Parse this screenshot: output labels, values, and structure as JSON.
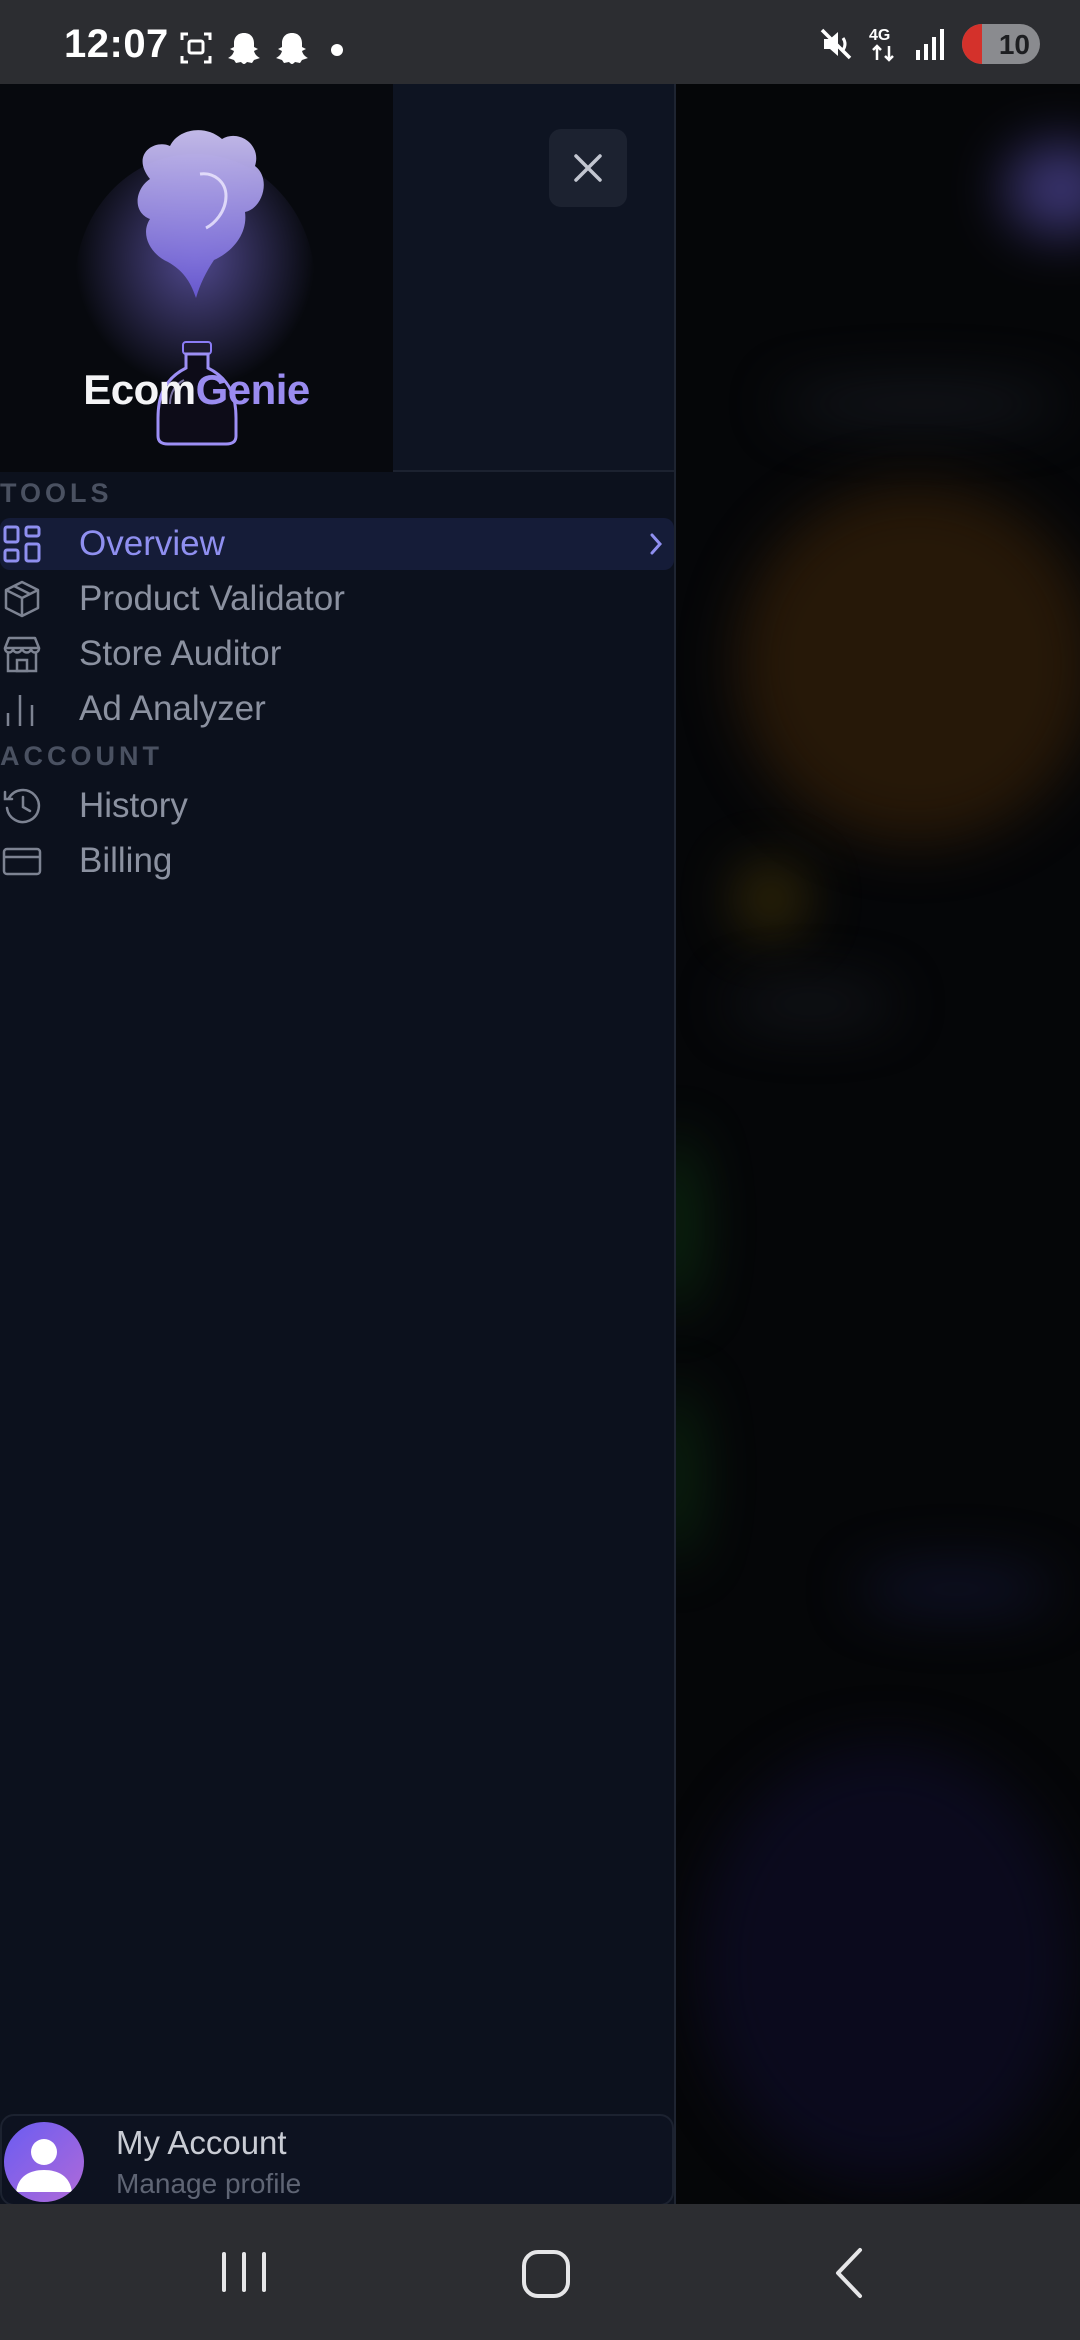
{
  "status_bar": {
    "time": "12:07",
    "left_icons": [
      "screenshot-icon",
      "snapchat-icon",
      "snapchat-icon",
      "dot-icon"
    ],
    "right_icons": [
      "mute-icon",
      "4g-icon",
      "signal-icon"
    ],
    "network": "4G",
    "battery_level": "10",
    "battery_color": "#d4312b"
  },
  "drawer": {
    "brand_part1": "Ecom",
    "brand_part2": "Genie",
    "brand_accent": "#9a8cf0",
    "close_icon": "close-icon",
    "sections": [
      {
        "label": "TOOLS",
        "items": [
          {
            "label": "Overview",
            "icon": "grid-icon",
            "active": true
          },
          {
            "label": "Product Validator",
            "icon": "box-icon",
            "active": false
          },
          {
            "label": "Store Auditor",
            "icon": "store-icon",
            "active": false
          },
          {
            "label": "Ad Analyzer",
            "icon": "bar-chart-icon",
            "active": false
          }
        ]
      },
      {
        "label": "ACCOUNT",
        "items": [
          {
            "label": "History",
            "icon": "history-icon",
            "active": false
          },
          {
            "label": "Billing",
            "icon": "credit-card-icon",
            "active": false
          }
        ]
      }
    ],
    "account": {
      "name": "My Account",
      "subtitle": "Manage profile"
    }
  },
  "nav_bar": {
    "buttons": [
      "recents-icon",
      "home-icon",
      "back-icon"
    ]
  }
}
